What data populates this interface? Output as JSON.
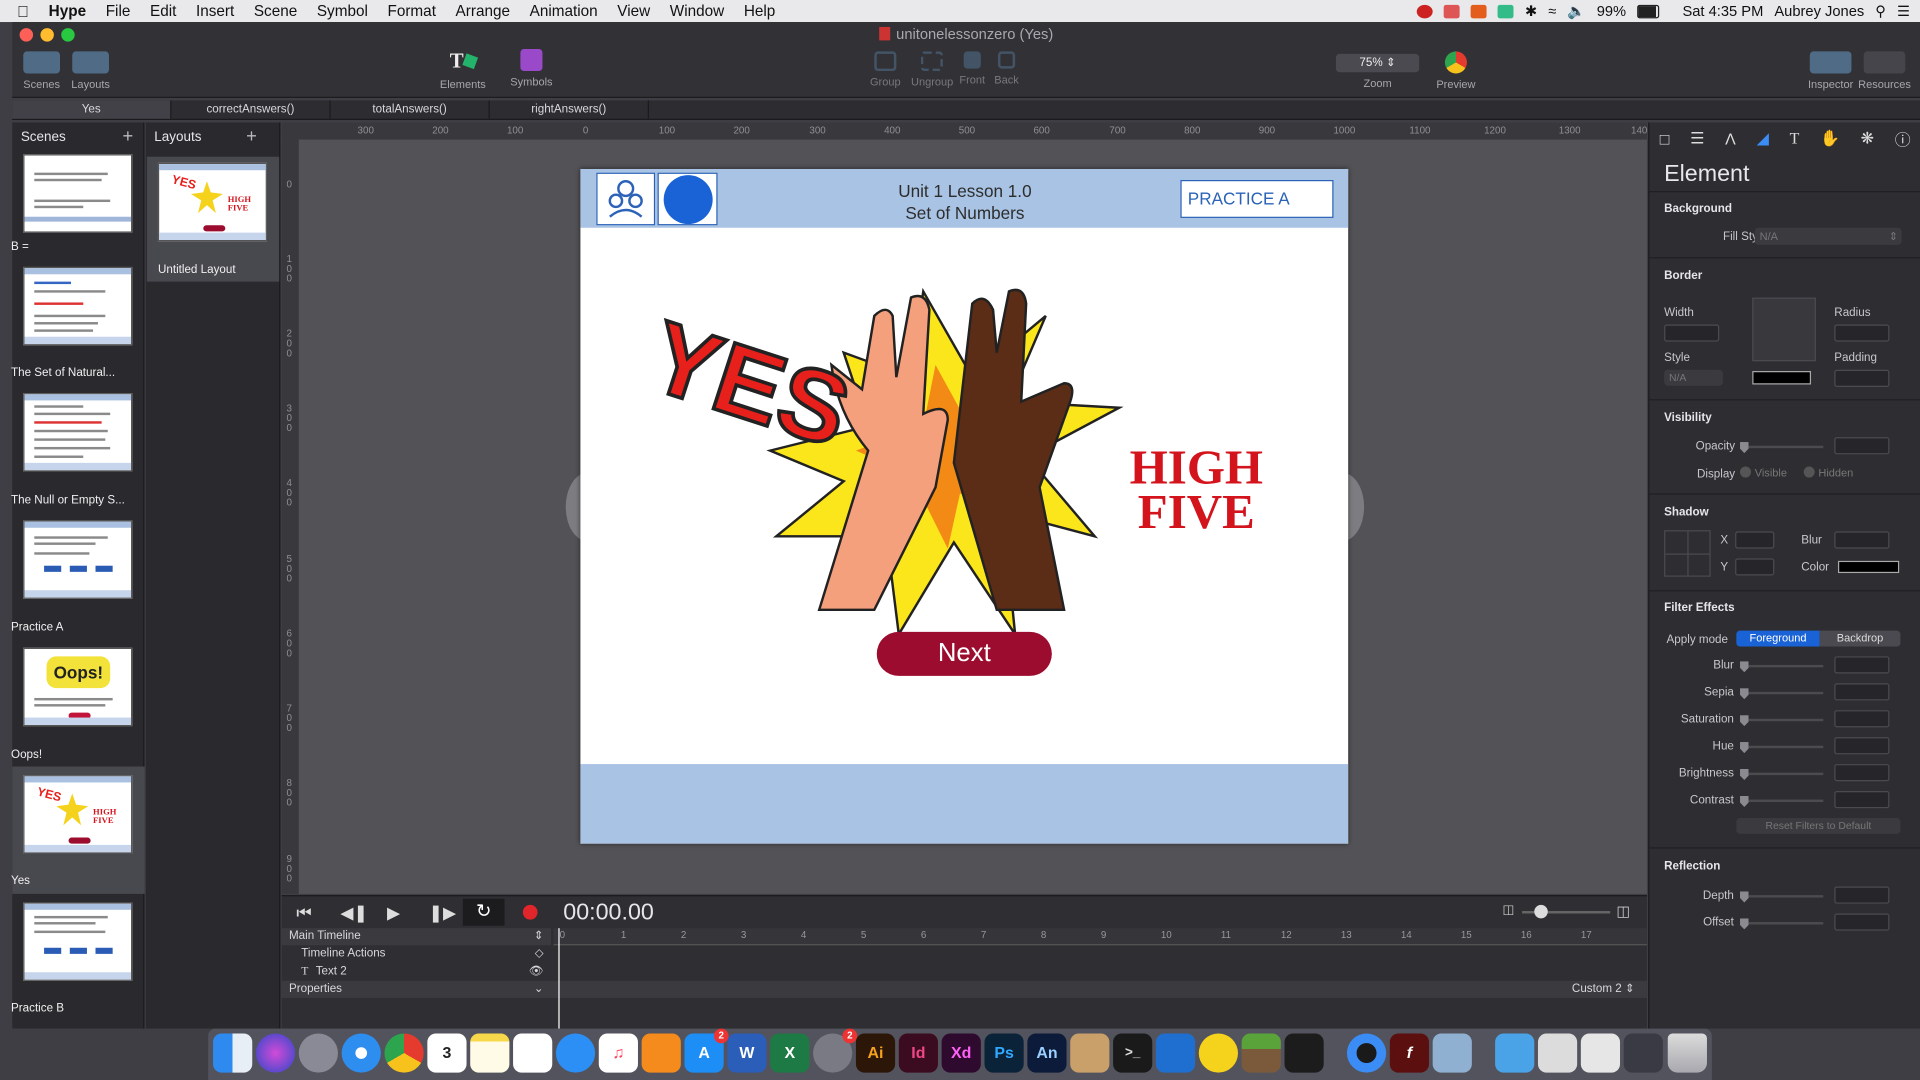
{
  "menubar": {
    "app": "Hype",
    "items": [
      "File",
      "Edit",
      "Insert",
      "Scene",
      "Symbol",
      "Format",
      "Arrange",
      "Animation",
      "View",
      "Window",
      "Help"
    ],
    "battery": "99%",
    "clock": "Sat 4:35 PM",
    "user": "Aubrey Jones"
  },
  "window": {
    "title": "unitonelessonzero (Yes)",
    "toolbar": {
      "scenes": "Scenes",
      "layouts": "Layouts",
      "elements": "Elements",
      "symbols": "Symbols",
      "group": "Group",
      "ungroup": "Ungroup",
      "front": "Front",
      "back": "Back",
      "zoom_value": "75%",
      "zoom": "Zoom",
      "preview": "Preview",
      "inspector": "Inspector",
      "resources": "Resources"
    },
    "tabs": [
      "Yes",
      "correctAnswers()",
      "totalAnswers()",
      "rightAnswers()"
    ]
  },
  "scenes_panel": {
    "title": "Scenes",
    "items": [
      {
        "label": "B ="
      },
      {
        "label": "The Set of Natural..."
      },
      {
        "label": "The Null or Empty S..."
      },
      {
        "label": "Practice A"
      },
      {
        "label": "Oops!"
      },
      {
        "label": "Yes"
      },
      {
        "label": "Practice B"
      }
    ]
  },
  "layouts_panel": {
    "title": "Layouts",
    "items": [
      {
        "label": "Untitled Layout"
      }
    ]
  },
  "ruler": {
    "h": [
      "300",
      "200",
      "100",
      "0",
      "100",
      "200",
      "300",
      "400",
      "500",
      "600",
      "700",
      "800",
      "900",
      "1000",
      "1100",
      "1200",
      "1300",
      "140"
    ],
    "v": [
      "0",
      "100",
      "200",
      "300",
      "400",
      "500",
      "600",
      "700",
      "800",
      "900"
    ]
  },
  "stage": {
    "title_line1": "Unit 1 Lesson 1.0",
    "title_line2": "Set of Numbers",
    "practice_badge": "PRACTICE A",
    "yes_text": "YES",
    "high_text": "HIGH",
    "five_text": "FIVE",
    "next_button": "Next"
  },
  "timeline": {
    "time": "00:00.00",
    "main_timeline": "Main Timeline",
    "timeline_actions": "Timeline Actions",
    "layer": "Text 2",
    "properties": "Properties",
    "custom": "Custom 2",
    "ticks": [
      "0",
      "1",
      "2",
      "3",
      "4",
      "5",
      "6",
      "7",
      "8",
      "9",
      "10",
      "11",
      "12",
      "13",
      "14",
      "15",
      "16",
      "17"
    ]
  },
  "inspector": {
    "title": "Element",
    "background": "Background",
    "fill_style": "Fill Style",
    "fill_value": "N/A",
    "border": "Border",
    "width": "Width",
    "radius": "Radius",
    "style": "Style",
    "style_value": "N/A",
    "padding": "Padding",
    "visibility": "Visibility",
    "opacity": "Opacity",
    "display": "Display",
    "visible": "Visible",
    "hidden": "Hidden",
    "shadow": "Shadow",
    "x": "X",
    "y": "Y",
    "blur": "Blur",
    "color": "Color",
    "filter_effects": "Filter Effects",
    "apply_mode": "Apply mode",
    "foreground": "Foreground",
    "backdrop": "Backdrop",
    "filters": [
      "Blur",
      "Sepia",
      "Saturation",
      "Hue",
      "Brightness",
      "Contrast"
    ],
    "reset_filters": "Reset Filters to Default",
    "reflection": "Reflection",
    "depth": "Depth",
    "offset": "Offset"
  },
  "dock": {
    "calendar_day": "3",
    "badge_appstore": "2",
    "badge_settings": "2",
    "apps": [
      "Finder",
      "Siri",
      "Launchpad",
      "Safari",
      "Chrome",
      "Calendar",
      "Notes",
      "Reminders",
      "Messages",
      "Music",
      "Books",
      "App Store",
      "Word",
      "Excel",
      "System Preferences",
      "Ai",
      "Id",
      "Xd",
      "Ps",
      "An",
      "Hype",
      "Terminal",
      "VS Code",
      "Cyberduck",
      "Minecraft",
      "Figma",
      "QuickTime",
      "Flash",
      "Preview",
      "Downloads",
      "Chrome Apps",
      "Documents",
      "Animate Doc",
      "Trash"
    ],
    "labels": {
      "ai": "Ai",
      "id": "Id",
      "xd": "Xd",
      "ps": "Ps",
      "an": "An",
      "word": "W",
      "excel": "X"
    }
  },
  "colors": {
    "accent": "#1a63d6",
    "stage_header": "#a8c3e3",
    "next_button": "#9b0c2e",
    "high_five_text": "#d4141c",
    "yes_red": "#e8201c"
  }
}
